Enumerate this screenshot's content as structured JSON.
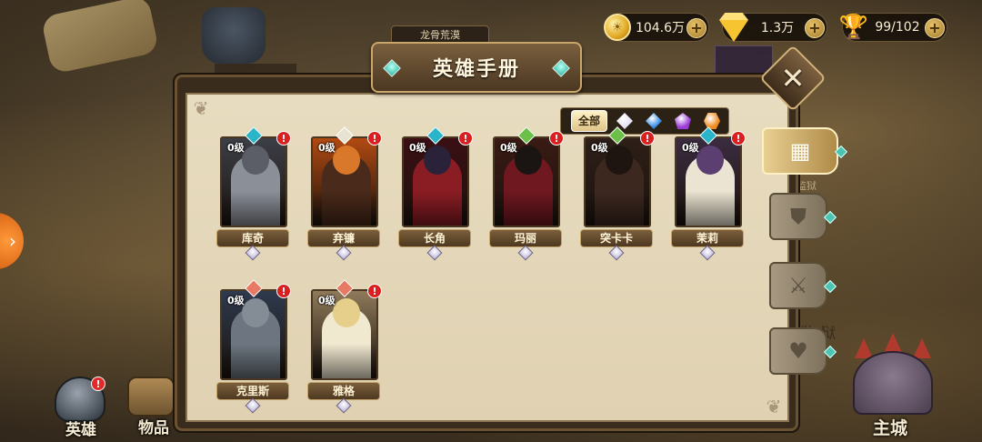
{
  "resources": {
    "gold": {
      "icon": "gold-coin-icon",
      "value": "104.6万"
    },
    "diamond": {
      "icon": "diamond-icon",
      "value": "1.3万"
    },
    "stamina": {
      "icon": "trophy-icon",
      "value": "99/102"
    }
  },
  "map": {
    "region_label": "龙骨荒漠",
    "prison_label": "监狱",
    "prison_label_big": "监 狱"
  },
  "panel": {
    "title": "英雄手册",
    "close_icon": "close-icon"
  },
  "filters": {
    "all_label": "全部",
    "options": [
      {
        "icon": "white-diamond-icon",
        "color": "#e4e0f4"
      },
      {
        "icon": "blue-diamond-icon",
        "color": "#2f8ae6"
      },
      {
        "icon": "purple-pentagon-icon",
        "color": "#9b3bd8"
      },
      {
        "icon": "orange-hexagon-icon",
        "color": "#f08a1c"
      }
    ]
  },
  "heroes": [
    {
      "name": "库奇",
      "level": "0级",
      "alert": "!",
      "bg": "#3c3f47",
      "body": "#8b8f98",
      "head": "#5b5e66",
      "class_color": "#2bb5c9"
    },
    {
      "name": "弃镰",
      "level": "0级",
      "alert": "!",
      "bg": "#b24a12",
      "body": "#4a2a1a",
      "head": "#d9782a",
      "class_color": "#e7e2d2"
    },
    {
      "name": "长角",
      "level": "0级",
      "alert": "!",
      "bg": "#3b0f14",
      "body": "#8a1d24",
      "head": "#2a2238",
      "class_color": "#2bb5c9"
    },
    {
      "name": "玛丽",
      "level": "0级",
      "alert": "!",
      "bg": "#3a1a14",
      "body": "#701820",
      "head": "#1a1412",
      "class_color": "#6cc04a"
    },
    {
      "name": "突卡卡",
      "level": "0级",
      "alert": "!",
      "bg": "#2e1f18",
      "body": "#3d2820",
      "head": "#1e1410",
      "class_color": "#6cc04a"
    },
    {
      "name": "茉莉",
      "level": "0级",
      "alert": "!",
      "bg": "#3b2c40",
      "body": "#ebe4d2",
      "head": "#5a3f70",
      "class_color": "#2bb5c9"
    },
    {
      "name": "克里斯",
      "level": "0级",
      "alert": "!",
      "bg": "#2e3a4e",
      "body": "#6d7680",
      "head": "#848c96",
      "class_color": "#e77a62"
    },
    {
      "name": "雅格",
      "level": "0级",
      "alert": "!",
      "bg": "#8f7a5a",
      "body": "#f1e8d0",
      "head": "#e6cf8a",
      "class_color": "#e77a62"
    }
  ],
  "side_tabs": [
    {
      "icon": "grid-icon",
      "glyph": "▦",
      "active": true
    },
    {
      "icon": "shield-icon",
      "glyph": "⛊",
      "active": false
    },
    {
      "icon": "sword-icon",
      "glyph": "⚔",
      "active": false
    },
    {
      "icon": "heart-icon",
      "glyph": "♥",
      "active": false
    }
  ],
  "bottom_nav": {
    "hero_label": "英雄",
    "hero_badge": "!",
    "items_label": "物品",
    "castle_label": "主城"
  },
  "left_arrow": "›"
}
